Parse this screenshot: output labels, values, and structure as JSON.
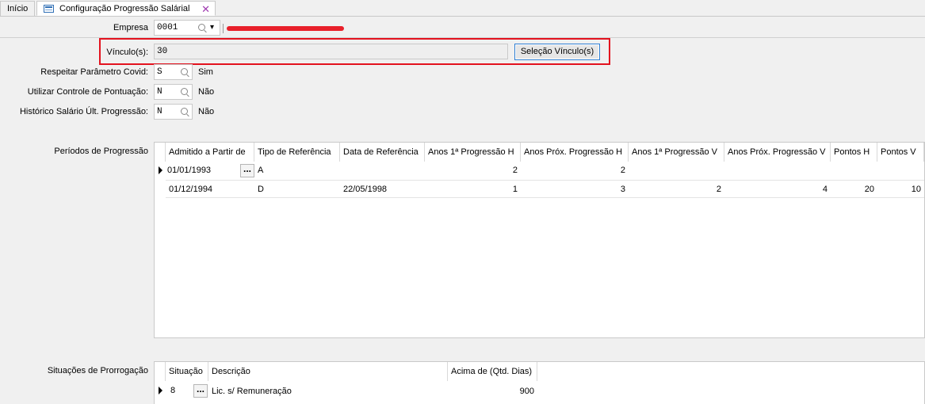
{
  "tabs": [
    {
      "label": "Início"
    },
    {
      "label": "Configuração Progressão Salárial"
    }
  ],
  "form": {
    "empresa_label": "Empresa",
    "empresa_value": "0001",
    "vinculos_label": "Vínculo(s):",
    "vinculos_value": "30",
    "selecao_button": "Seleção Vínculo(s)",
    "covid_label": "Respeitar Parâmetro Covid:",
    "covid_value": "S",
    "covid_text": "Sim",
    "pontuacao_label": "Utilizar Controle de Pontuação:",
    "pontuacao_value": "N",
    "pontuacao_text": "Não",
    "historico_label": "Histórico Salário Últ. Progressão:",
    "historico_value": "N",
    "historico_text": "Não"
  },
  "periodos": {
    "label": "Períodos de Progressão",
    "columns": [
      "Admitido a Partir de",
      "Tipo de Referência",
      "Data de Referência",
      "Anos 1ª Progressão H",
      "Anos Próx. Progressão H",
      "Anos 1ª Progressão V",
      "Anos Próx. Progressão V",
      "Pontos H",
      "Pontos V"
    ],
    "rows": [
      [
        "01/01/1993",
        "A",
        "",
        "2",
        "2",
        "",
        "",
        "",
        ""
      ],
      [
        "01/12/1994",
        "D",
        "22/05/1998",
        "1",
        "3",
        "2",
        "4",
        "20",
        "10"
      ]
    ]
  },
  "situacoes": {
    "label": "Situações de Prorrogação",
    "columns": [
      "Situação",
      "Descrição",
      "Acima de (Qtd. Dias)"
    ],
    "rows": [
      [
        "8",
        "Lic. s/ Remuneração",
        "900"
      ]
    ]
  },
  "icons": {
    "tab_form": "form-icon",
    "tab_close": "close-icon",
    "lookup": "search-icon",
    "dropdown": "dropdown-icon",
    "row_pointer": "row-pointer-icon",
    "ellipsis": "ellipsis-icon"
  }
}
